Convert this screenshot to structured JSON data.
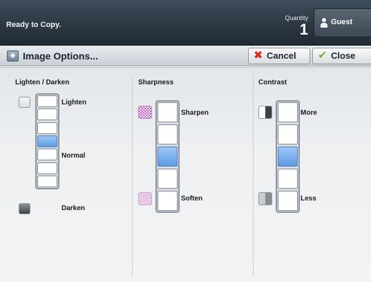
{
  "status": {
    "text": "Ready to Copy.",
    "quantity_label": "Quantity",
    "quantity_value": "1",
    "user_label": "Guest",
    "user_icon": "user-icon"
  },
  "titlebar": {
    "title": "Image Options...",
    "title_icon": "image-options-icon",
    "cancel_label": "Cancel",
    "cancel_icon": "x-icon",
    "close_label": "Close",
    "close_icon": "checkmark-icon"
  },
  "lighten_darken": {
    "heading": "Lighten / Darken",
    "top_label": "Lighten",
    "middle_label": "Normal",
    "bottom_label": "Darken",
    "steps": 7,
    "selected_step": 4
  },
  "sharpness": {
    "heading": "Sharpness",
    "top_label": "Sharpen",
    "bottom_label": "Soften",
    "steps": 5,
    "selected_step": 3
  },
  "contrast": {
    "heading": "Contrast",
    "top_label": "More",
    "bottom_label": "Less",
    "steps": 5,
    "selected_step": 3
  },
  "colors": {
    "selected_cell": "#5f9ce4",
    "status_bar": "#2b3641",
    "cancel_icon": "#d62b1f",
    "close_icon": "#6fb53a"
  }
}
